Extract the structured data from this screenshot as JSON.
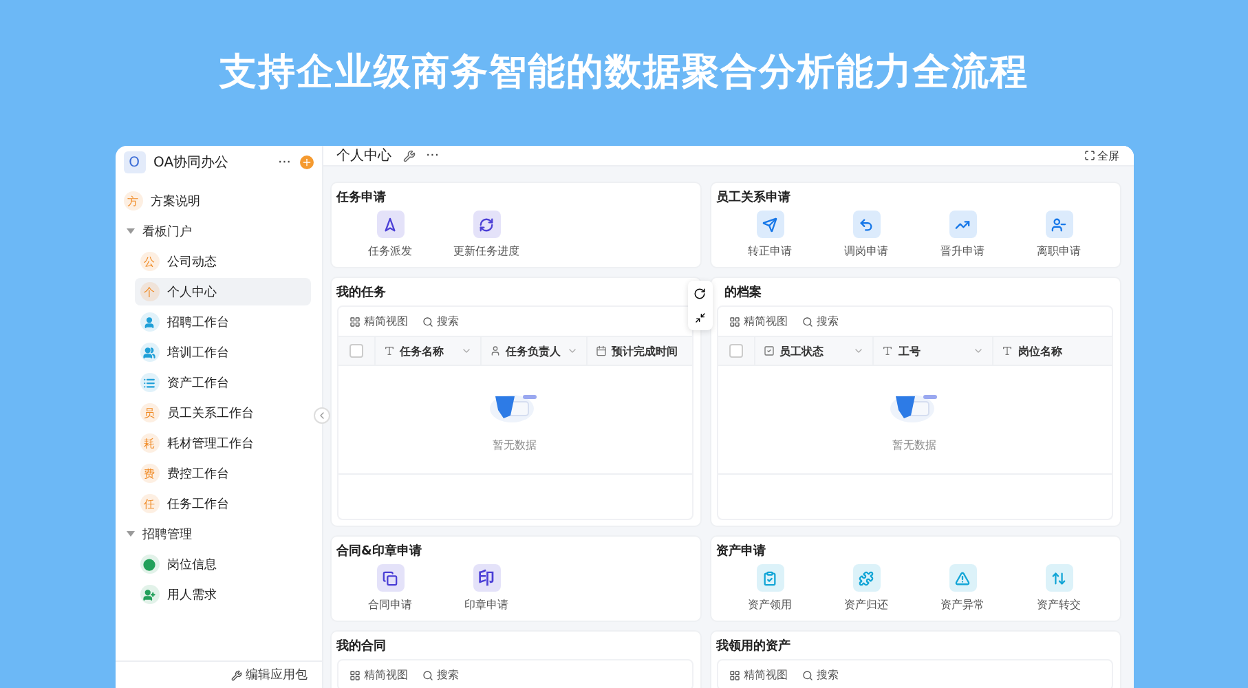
{
  "headline": "支持企业级商务智能的数据聚合分析能力全流程",
  "sidebar": {
    "logo": "O",
    "app_name": "OA协同办公",
    "more": "···",
    "footer": "编辑应用包",
    "items": [
      {
        "kind": "page",
        "label": "方案说明",
        "icon_text": "方",
        "color": "#f08a24",
        "selected": false
      },
      {
        "kind": "group",
        "label": "看板门户",
        "expanded": true,
        "children": [
          {
            "kind": "page",
            "label": "公司动态",
            "icon_text": "公",
            "color": "#f08a24",
            "selected": false
          },
          {
            "kind": "page",
            "label": "个人中心",
            "icon_text": "个",
            "color": "#f08a24",
            "selected": true
          },
          {
            "kind": "page",
            "label": "招聘工作台",
            "color": "#1fa0d8",
            "selected": false
          },
          {
            "kind": "page",
            "label": "培训工作台",
            "color": "#1fa0d8",
            "selected": false
          },
          {
            "kind": "page",
            "label": "资产工作台",
            "color": "#1fa0d8",
            "selected": false
          },
          {
            "kind": "page",
            "label": "员工关系工作台",
            "icon_text": "员",
            "color": "#f08a24",
            "selected": false
          },
          {
            "kind": "page",
            "label": "耗材管理工作台",
            "icon_text": "耗",
            "color": "#f08a24",
            "selected": false
          },
          {
            "kind": "page",
            "label": "费控工作台",
            "icon_text": "费",
            "color": "#f08a24",
            "selected": false
          },
          {
            "kind": "page",
            "label": "任务工作台",
            "icon_text": "任",
            "color": "#f08a24",
            "selected": false
          }
        ]
      },
      {
        "kind": "group",
        "label": "招聘管理",
        "expanded": true,
        "children": [
          {
            "kind": "page",
            "label": "岗位信息",
            "color": "#22a05a",
            "selected": false
          },
          {
            "kind": "page",
            "label": "用人需求",
            "color": "#22a05a",
            "selected": false
          }
        ]
      }
    ]
  },
  "topbar": {
    "title": "个人中心",
    "more": "···",
    "fullscreen": "全屏"
  },
  "cards": [
    {
      "kind": "actions",
      "title": "任务申请",
      "actions": [
        {
          "label": "任务派发",
          "color": "#4b3fd6"
        },
        {
          "label": "更新任务进度",
          "color": "#4b3fd6"
        }
      ]
    },
    {
      "kind": "actions",
      "title": "员工关系申请",
      "actions": [
        {
          "label": "转正申请",
          "color": "#1677e8"
        },
        {
          "label": "调岗申请",
          "color": "#1677e8"
        },
        {
          "label": "晋升申请",
          "color": "#1677e8"
        },
        {
          "label": "离职申请",
          "color": "#1677e8"
        }
      ]
    },
    {
      "kind": "table",
      "title": "我的任务",
      "hover_toolbar": false,
      "view": "精简视图",
      "search": "搜索",
      "select_all_checked": false,
      "columns": [
        "任务名称",
        "任务负责人",
        "预计完成时间"
      ],
      "empty": "暂无数据"
    },
    {
      "kind": "table",
      "title": "的档案",
      "hover_toolbar": true,
      "view": "精简视图",
      "search": "搜索",
      "select_all_checked": false,
      "columns": [
        "员工状态",
        "工号",
        "岗位名称"
      ],
      "empty": "暂无数据"
    },
    {
      "kind": "actions",
      "title": "合同&印章申请",
      "actions": [
        {
          "label": "合同申请",
          "color": "#4b3fd6"
        },
        {
          "label": "印章申请",
          "icon_text": "印",
          "color": "#4b3fd6"
        }
      ]
    },
    {
      "kind": "actions",
      "title": "资产申请",
      "actions": [
        {
          "label": "资产领用",
          "color": "#12a5d6"
        },
        {
          "label": "资产归还",
          "color": "#12a5d6"
        },
        {
          "label": "资产异常",
          "color": "#12a5d6"
        },
        {
          "label": "资产转交",
          "color": "#12a5d6"
        }
      ]
    },
    {
      "kind": "table_stub",
      "title": "我的合同",
      "view": "精简视图",
      "search": "搜索"
    },
    {
      "kind": "table_stub",
      "title": "我领用的资产",
      "view": "精简视图",
      "search": "搜索"
    }
  ]
}
